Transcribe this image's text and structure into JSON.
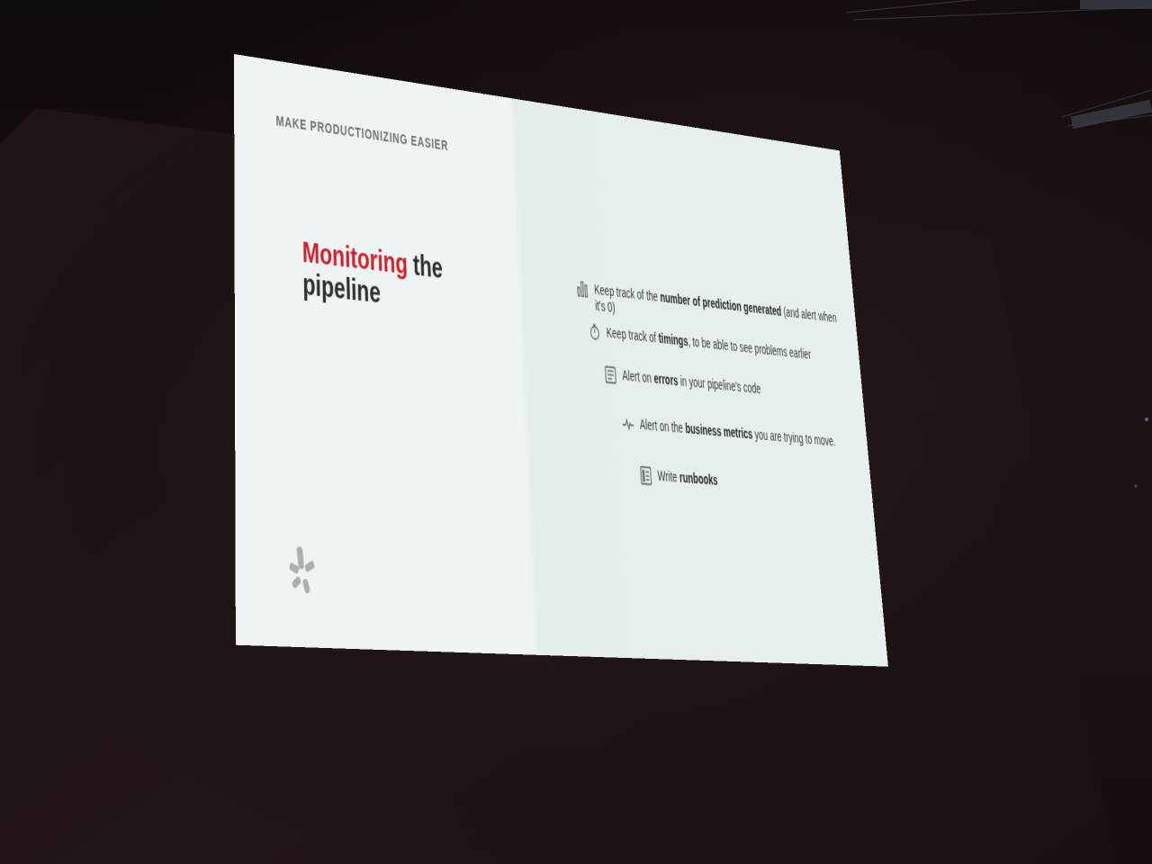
{
  "slide": {
    "kicker": "MAKE PRODUCTIONIZING EASIER",
    "title_highlight": "Monitoring",
    "title_rest_1": " the",
    "title_rest_2": "pipeline",
    "accent_color": "#d0202d",
    "bullets": [
      {
        "icon": "bar-chart-icon",
        "pre": "Keep track of the ",
        "bold": "number of prediction generated",
        "post": " (and alert when it's 0)"
      },
      {
        "icon": "stopwatch-icon",
        "pre": "Keep track of ",
        "bold": "timings",
        "post": ", to be able to see problems earlier"
      },
      {
        "icon": "document-icon",
        "pre": "Alert on ",
        "bold": "errors",
        "post": " in your pipeline's code"
      },
      {
        "icon": "pulse-icon",
        "pre": "Alert on the ",
        "bold": "business metrics",
        "post": " you are trying to move."
      },
      {
        "icon": "checklist-icon",
        "pre": "Write ",
        "bold": "runbooks",
        "post": ""
      }
    ],
    "logo_icon": "burst-logo-icon"
  }
}
